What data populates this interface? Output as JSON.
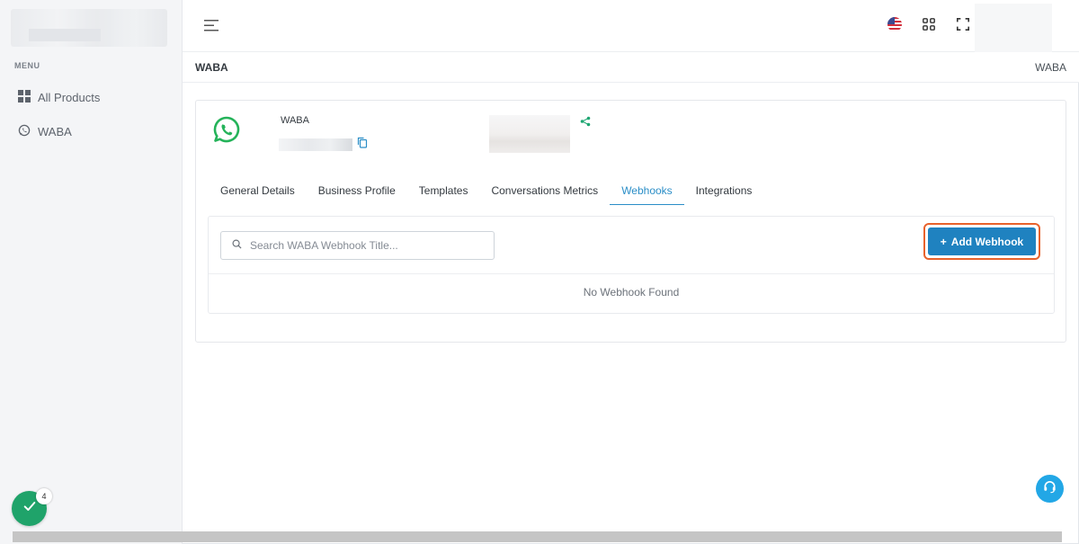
{
  "sidebar": {
    "menu_title": "MENU",
    "items": [
      {
        "label": "All Products",
        "icon": "grid-icon"
      },
      {
        "label": "WABA",
        "icon": "whatsapp-icon"
      }
    ]
  },
  "header": {
    "icons": [
      "menu-icon",
      "us-flag-icon",
      "apps-icon",
      "fullscreen-icon"
    ]
  },
  "page": {
    "title": "WABA",
    "breadcrumb": "WABA"
  },
  "account": {
    "name": "WABA",
    "icon": "whatsapp-icon"
  },
  "tabs": [
    {
      "label": "General Details",
      "active": false
    },
    {
      "label": "Business Profile",
      "active": false
    },
    {
      "label": "Templates",
      "active": false
    },
    {
      "label": "Conversations Metrics",
      "active": false
    },
    {
      "label": "Webhooks",
      "active": true
    },
    {
      "label": "Integrations",
      "active": false
    }
  ],
  "webhooks": {
    "search_placeholder": "Search WABA Webhook Title...",
    "search_value": "",
    "add_button_label": "Add Webhook",
    "empty_message": "No Webhook Found"
  },
  "floating": {
    "task_badge_count": "4"
  },
  "colors": {
    "accent": "#1f82c0",
    "active_tab": "#2b8ec7",
    "highlight": "#e8622c",
    "whatsapp": "#25b35a",
    "support": "#22a7e6",
    "check": "#1fa36a"
  }
}
